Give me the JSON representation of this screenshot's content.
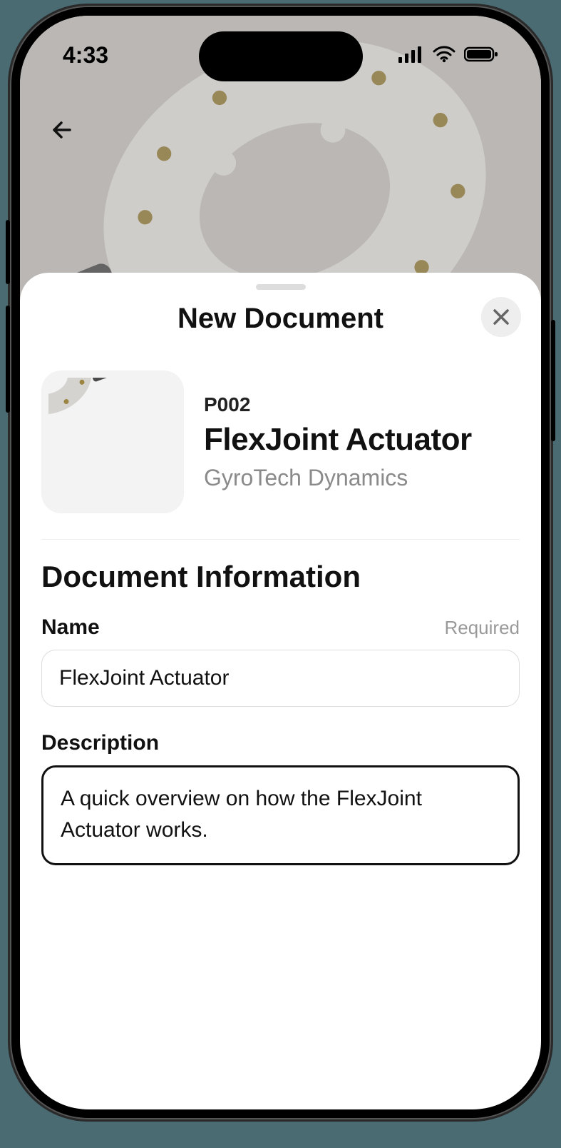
{
  "status": {
    "time": "4:33"
  },
  "sheet": {
    "title": "New Document"
  },
  "product": {
    "sku": "P002",
    "name": "FlexJoint Actuator",
    "vendor": "GyroTech Dynamics"
  },
  "section": {
    "title": "Document Information"
  },
  "fields": {
    "name": {
      "label": "Name",
      "hint": "Required",
      "value": "FlexJoint Actuator"
    },
    "description": {
      "label": "Description",
      "value": "A quick overview on how the FlexJoint Actuator works. "
    }
  }
}
